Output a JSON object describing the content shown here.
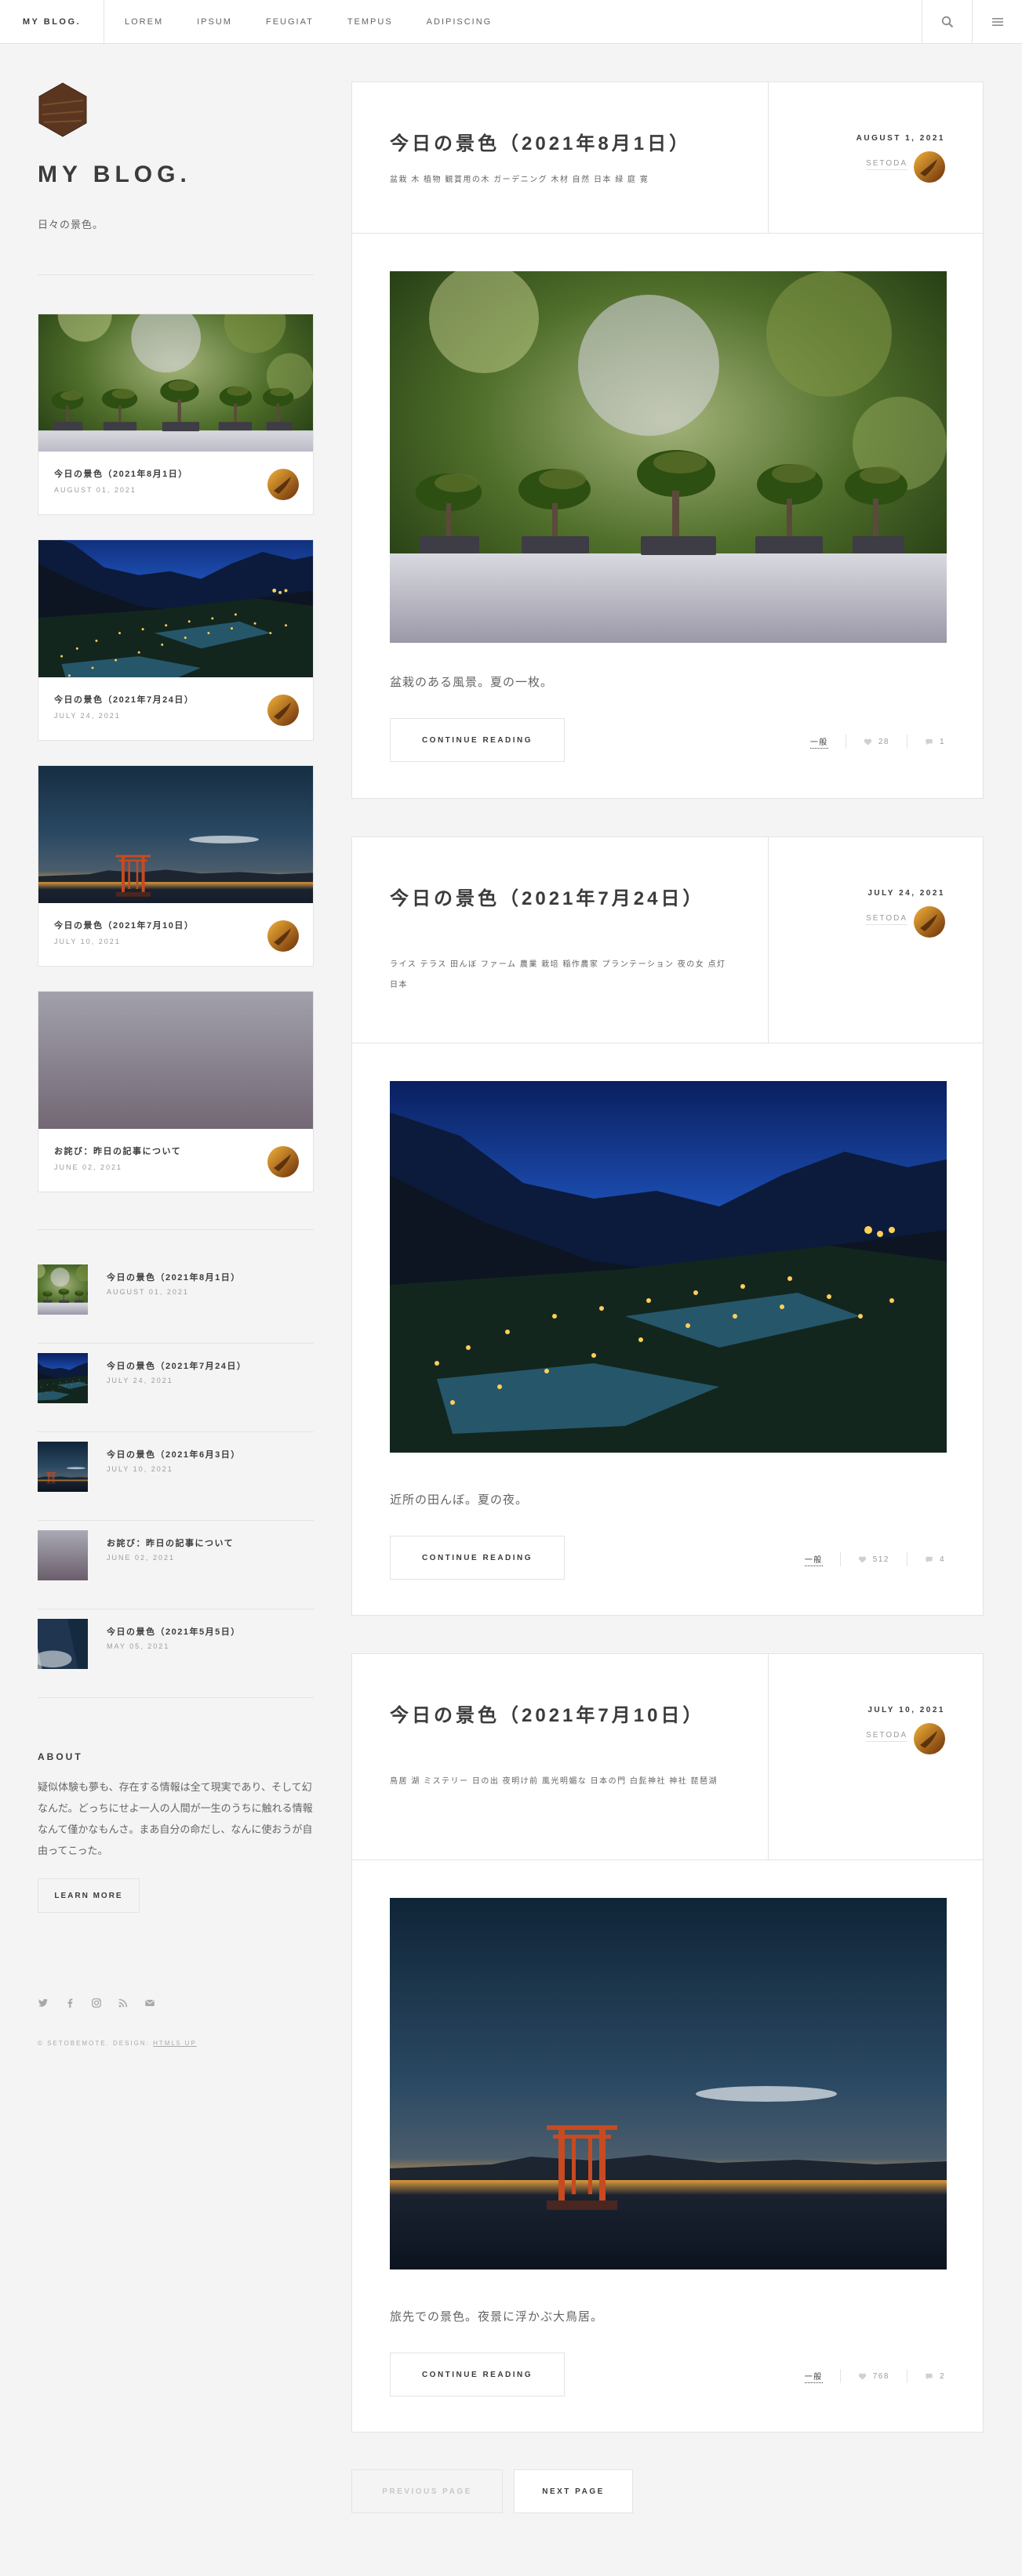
{
  "header": {
    "brand": "MY BLOG.",
    "nav": [
      "LOREM",
      "IPSUM",
      "FEUGIAT",
      "TEMPUS",
      "ADIPISCING"
    ],
    "search_icon": "search-icon",
    "menu_icon": "menu-icon"
  },
  "sidebar": {
    "title": "MY BLOG.",
    "subtitle": "日々の景色。",
    "mini_posts": [
      {
        "title": "今日の景色（2021年8月1日）",
        "date": "AUGUST 01, 2021"
      },
      {
        "title": "今日の景色（2021年7月24日）",
        "date": "JULY 24, 2021"
      },
      {
        "title": "今日の景色（2021年7月10日）",
        "date": "JULY 10, 2021"
      },
      {
        "title": "お詫び：昨日の記事について",
        "date": "JUNE 02, 2021"
      }
    ],
    "post_list": [
      {
        "title": "今日の景色（2021年8月1日）",
        "date": "AUGUST 01, 2021"
      },
      {
        "title": "今日の景色（2021年7月24日）",
        "date": "JULY 24, 2021"
      },
      {
        "title": "今日の景色（2021年6月3日）",
        "date": "JULY 10, 2021"
      },
      {
        "title": "お詫び：昨日の記事について",
        "date": "JUNE 02, 2021"
      },
      {
        "title": "今日の景色（2021年5月5日）",
        "date": "MAY 05, 2021"
      }
    ],
    "about_heading": "ABOUT",
    "about_text": "疑似体験も夢も、存在する情報は全て現実であり、そして幻なんだ。どっちにせよ一人の人間が一生のうちに触れる情報なんて僅かなもんさ。まあ自分の命だし、なんに使おうが自由ってこった。",
    "learn_more": "LEARN MORE",
    "copyright_prefix": "© SETOBEMOTE. DESIGN: ",
    "copyright_link": "HTML5 UP"
  },
  "posts": [
    {
      "title": "今日の景色（2021年8月1日）",
      "tags": "盆栽 木 植物 観賞用の木 ガーデニング 木材 自然 日本 緑 庭 寛",
      "date": "AUGUST 1, 2021",
      "author": "SETODA",
      "excerpt": "盆栽のある風景。夏の一枚。",
      "continue": "CONTINUE READING",
      "category": "一般",
      "likes": "28",
      "comments": "1"
    },
    {
      "title": "今日の景色（2021年7月24日）",
      "tags": "ライス テラス 田んぼ ファーム 農業 栽培 稲作農家 プランテーション 夜の女 点灯 日本",
      "date": "JULY 24, 2021",
      "author": "SETODA",
      "excerpt": "近所の田んぼ。夏の夜。",
      "continue": "CONTINUE READING",
      "category": "一般",
      "likes": "512",
      "comments": "4"
    },
    {
      "title": "今日の景色（2021年7月10日）",
      "tags": "鳥居 湖 ミステリー 日の出 夜明け前 風光明媚な 日本の門 白髭神社 神社 琵琶湖",
      "date": "JULY 10, 2021",
      "author": "SETODA",
      "excerpt": "旅先での景色。夜景に浮かぶ大鳥居。",
      "continue": "CONTINUE READING",
      "category": "一般",
      "likes": "768",
      "comments": "2"
    }
  ],
  "pagination": {
    "prev": "PREVIOUS PAGE",
    "next": "NEXT PAGE"
  }
}
